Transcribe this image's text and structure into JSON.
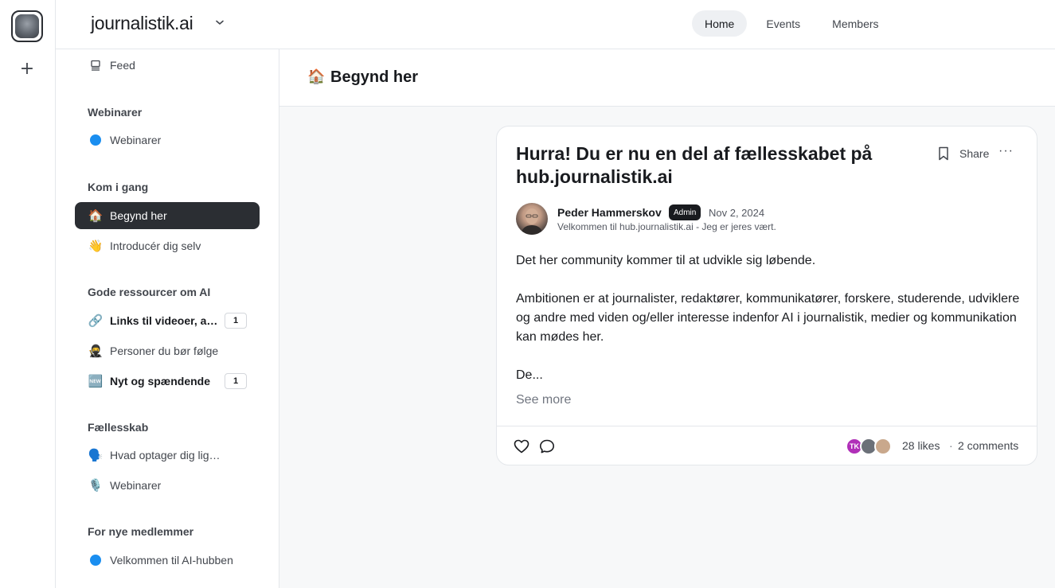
{
  "header": {
    "brand": "journalistik.ai",
    "nav": [
      {
        "label": "Home",
        "active": true
      },
      {
        "label": "Events",
        "active": false
      },
      {
        "label": "Members",
        "active": false
      }
    ]
  },
  "sidebar": {
    "feed": {
      "label": "Feed"
    },
    "sections": [
      {
        "heading": "Webinarer",
        "items": [
          {
            "label": "Webinarer",
            "icon": "blue-dot"
          }
        ]
      },
      {
        "heading": "Kom i gang",
        "items": [
          {
            "label": "Begynd her",
            "icon": "🏠",
            "active": true
          },
          {
            "label": "Introducér dig selv",
            "icon": "👋"
          }
        ]
      },
      {
        "heading": "Gode ressourcer om AI",
        "items": [
          {
            "label": "Links til videoer, art...",
            "icon": "🔗",
            "badge": "1",
            "bold": true
          },
          {
            "label": "Personer du bør følge",
            "icon": "🥷"
          },
          {
            "label": "Nyt og spændende",
            "icon": "🆕",
            "badge": "1",
            "bold": true
          }
        ]
      },
      {
        "heading": "Fællesskab",
        "items": [
          {
            "label": "Hvad optager dig lige nu?...",
            "icon": "🗣️"
          },
          {
            "label": "Webinarer",
            "icon": "🎙️"
          }
        ]
      },
      {
        "heading": "For nye medlemmer",
        "items": [
          {
            "label": "Velkommen til AI-hubben",
            "icon": "blue-dot"
          }
        ]
      }
    ]
  },
  "page": {
    "emoji": "🏠",
    "title": "Begynd her"
  },
  "post": {
    "title": "Hurra! Du er nu en del af fællesskabet på hub.journalistik.ai",
    "share_label": "Share",
    "more_label": "···",
    "author": "Peder Hammerskov",
    "author_badge": "Admin",
    "date": "Nov 2, 2024",
    "author_subtitle": "Velkommen til hub.journalistik.ai - Jeg er jeres vært.",
    "body": [
      "Det her community kommer til at udvikle sig løbende.",
      "Ambitionen er at journalister, redaktører, kommunikatører, forskere, studerende, udviklere og andre med viden og/eller interesse indenfor AI i journalistik, medier og kommunikation kan mødes her.",
      "De..."
    ],
    "see_more": "See more",
    "likers": [
      {
        "initials": "TK",
        "color": "#b02fb8"
      },
      {
        "initials": "",
        "color": "#6b7078"
      },
      {
        "initials": "",
        "color": "#c9a88c"
      }
    ],
    "likes": "28 likes",
    "separator": "·",
    "comments": "2 comments"
  },
  "colors": {
    "accent": "#2b2e33",
    "dot": "#1a8ef0",
    "admin_badge": "#191b1f"
  }
}
